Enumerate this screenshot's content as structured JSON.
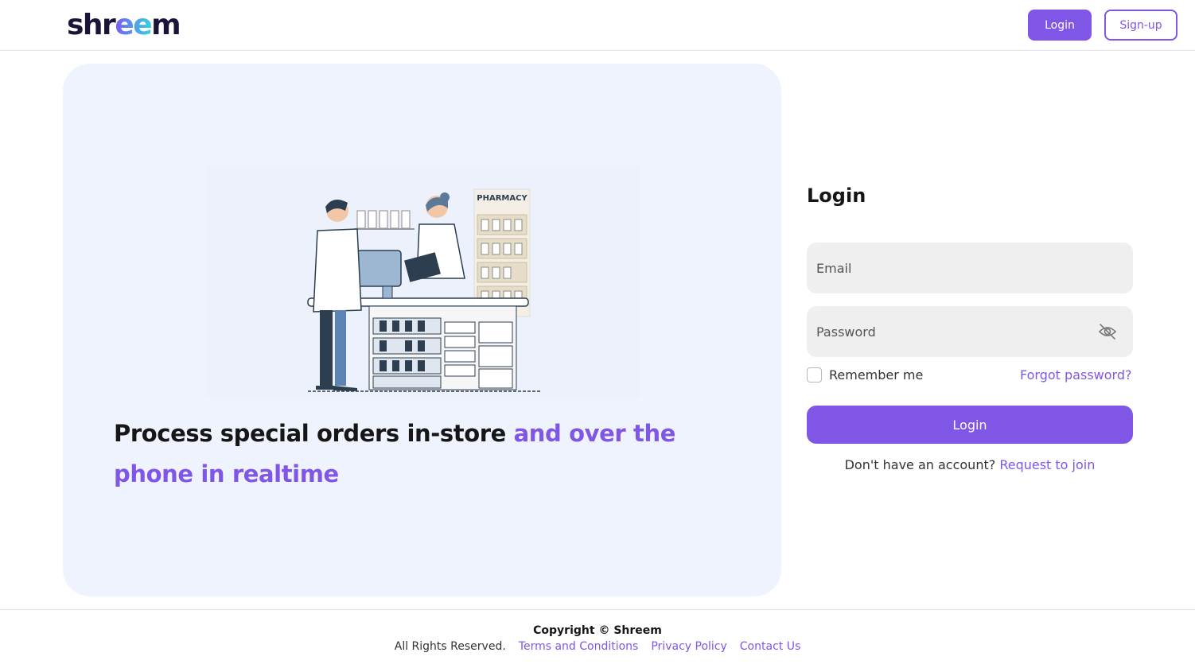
{
  "header": {
    "logo_text": "shreem",
    "login_label": "Login",
    "signup_label": "Sign-up"
  },
  "hero": {
    "illustration_sign": "PHARMACY",
    "headline_plain": "Process special orders in-store ",
    "headline_accent": "and over the phone in realtime"
  },
  "login_form": {
    "title": "Login",
    "email_placeholder": "Email",
    "password_placeholder": "Password",
    "remember_label": "Remember me",
    "forgot_label": "Forgot password?",
    "submit_label": "Login",
    "no_account_text": "Don't have an account?",
    "request_link": "Request to join"
  },
  "footer": {
    "copyright": "Copyright © Shreem",
    "rights": "All Rights Reserved.",
    "links": [
      "Terms and Conditions",
      "Privacy Policy",
      "Contact Us"
    ]
  },
  "colors": {
    "accent": "#7f56e6",
    "hero_bg": "#eef3fd",
    "field_bg": "#efefef"
  }
}
